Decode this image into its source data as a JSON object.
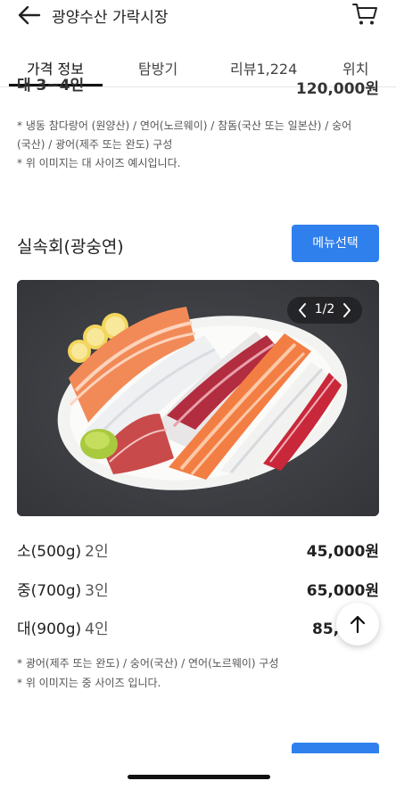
{
  "header": {
    "title": "광양수산 가락시장",
    "back_icon": "arrow-left-icon",
    "cart_icon": "cart-icon"
  },
  "tabs": [
    {
      "label": "가격 정보",
      "active": true
    },
    {
      "label": "탐방기",
      "active": false
    },
    {
      "label": "리뷰1,224",
      "active": false
    },
    {
      "label": "위치",
      "active": false
    }
  ],
  "prev_section": {
    "cut_label": "대 3~4인",
    "cut_price": "120,000원",
    "note_lines": [
      "* 냉동 참다랑어 (원양산) / 연어(노르웨이) / 참돔(국산 또는 일본산) / 숭어",
      "(국산) / 광어(제주 또는 완도) 구성",
      "* 위 이미지는 대 사이즈 예시입니다."
    ]
  },
  "menu": {
    "title": "실속회(광숭연)",
    "select_button": "메뉴선택",
    "photo_counter": "1/2",
    "prices": [
      {
        "size": "소(500g)",
        "people": "2인",
        "price": "45,000원"
      },
      {
        "size": "중(700g)",
        "people": "3인",
        "price": "65,000원"
      },
      {
        "size": "대(900g)",
        "people": "4인",
        "price": "85,000원"
      }
    ],
    "note_lines": [
      "* 광어(제주 또는 완도) / 숭어(국산) / 연어(노르웨이) 구성",
      "* 위 이미지는 중 사이즈 입니다."
    ]
  },
  "scroll_top_icon": "arrow-up-icon",
  "colors": {
    "accent": "#2f80ed",
    "photo_bg": "#3d3f44"
  }
}
